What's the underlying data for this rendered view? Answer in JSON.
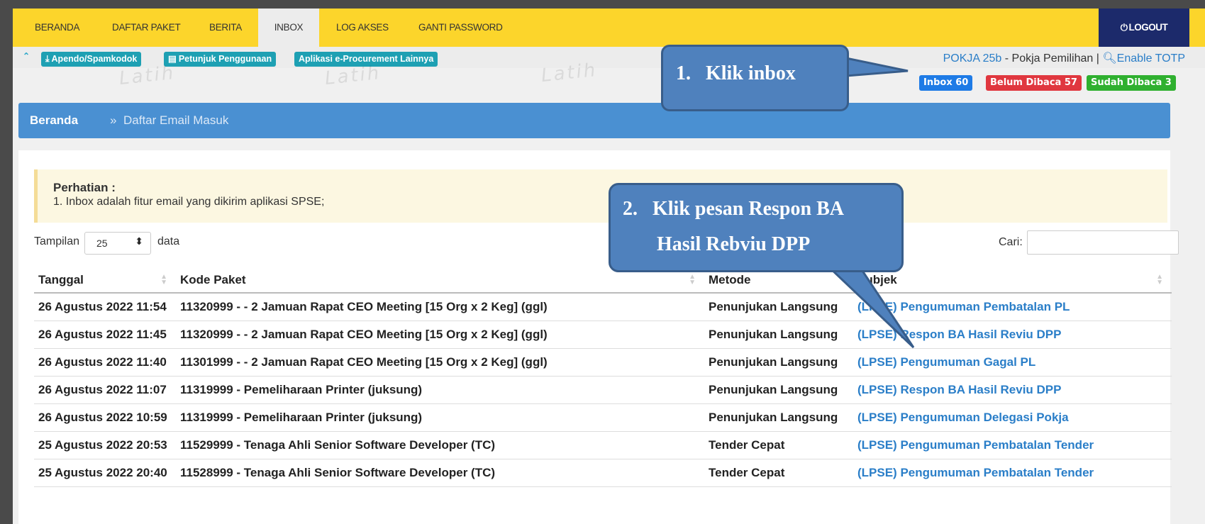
{
  "nav": {
    "items": [
      "BERANDA",
      "DAFTAR PAKET",
      "BERITA",
      "INBOX",
      "LOG AKSES",
      "GANTI PASSWORD"
    ],
    "active": "INBOX",
    "logout": "LOGOUT"
  },
  "toolbar": {
    "buttons": [
      "Apendo/Spamkodok",
      "Petunjuk Penggunaan",
      "Aplikasi e-Procurement Lainnya"
    ]
  },
  "user": {
    "pokja": "POKJA 25b",
    "role": " - Pokja Pemilihan | ",
    "totp": "Enable TOTP"
  },
  "badges": {
    "inbox": "Inbox 60",
    "unread": "Belum Dibaca 57",
    "read": "Sudah Dibaca 3"
  },
  "watermark": "Latih",
  "breadcrumb": {
    "home": "Beranda",
    "sep": "»",
    "current": "Daftar Email Masuk"
  },
  "notice": {
    "title": "Perhatian :",
    "text": "1. Inbox adalah fitur email yang dikirim aplikasi SPSE;"
  },
  "table_controls": {
    "show_label": "Tampilan",
    "show_value": "25",
    "show_after": "data",
    "search_label": "Cari:"
  },
  "table": {
    "headers": [
      "Tanggal",
      "Kode Paket",
      "Metode",
      "Subjek"
    ],
    "rows": [
      [
        "26 Agustus 2022 11:54",
        "11320999 - - 2 Jamuan Rapat CEO Meeting [15 Org x 2 Keg] (ggl)",
        "Penunjukan Langsung",
        "(LPSE) Pengumuman Pembatalan PL"
      ],
      [
        "26 Agustus 2022 11:45",
        "11320999 - - 2 Jamuan Rapat CEO Meeting [15 Org x 2 Keg] (ggl)",
        "Penunjukan Langsung",
        "(LPSE) Respon BA Hasil Reviu DPP"
      ],
      [
        "26 Agustus 2022 11:40",
        "11301999 - - 2 Jamuan Rapat CEO Meeting [15 Org x 2 Keg] (ggl)",
        "Penunjukan Langsung",
        "(LPSE) Pengumuman Gagal PL"
      ],
      [
        "26 Agustus 2022 11:07",
        "11319999 - Pemeliharaan Printer (juksung)",
        "Penunjukan Langsung",
        "(LPSE) Respon BA Hasil Reviu DPP"
      ],
      [
        "26 Agustus 2022 10:59",
        "11319999 - Pemeliharaan Printer (juksung)",
        "Penunjukan Langsung",
        "(LPSE) Pengumuman Delegasi Pokja"
      ],
      [
        "25 Agustus 2022 20:53",
        "11529999 - Tenaga Ahli Senior Software Developer (TC)",
        "Tender Cepat",
        "(LPSE) Pengumuman Pembatalan Tender"
      ],
      [
        "25 Agustus 2022 20:40",
        "11528999 - Tenaga Ahli Senior Software Developer (TC)",
        "Tender Cepat",
        "(LPSE) Pengumuman Pembatalan Tender"
      ]
    ]
  },
  "callouts": {
    "one": "1.   Klik inbox",
    "two_line1": "2.   Klik pesan Respon BA",
    "two_line2": "Hasil Rebviu DPP"
  },
  "colors": {
    "nav_bg": "#fcd52b",
    "logout_bg": "#1c2a6b",
    "accent": "#4a90d2",
    "link": "#2a7ec8",
    "badge_inbox": "#1e7be6",
    "badge_unread": "#e0373f",
    "badge_read": "#2fb02f",
    "callout": "#4f81bd"
  },
  "icons": [
    "chevron-up-icon",
    "download-icon",
    "book-icon",
    "key-icon",
    "power-icon",
    "sort-icon"
  ]
}
